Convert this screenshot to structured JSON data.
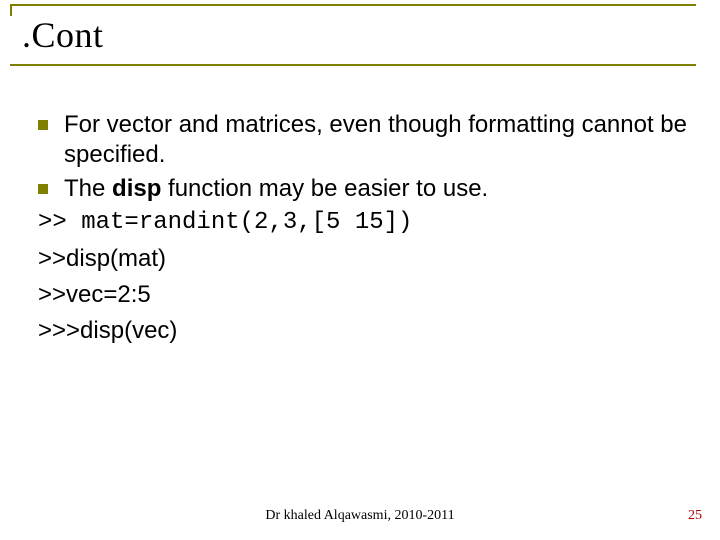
{
  "title": ".Cont",
  "bullets": [
    {
      "html": "For vector and matrices, even though formatting cannot be specified."
    },
    {
      "html": "The <span class=\"bold\">disp</span> function may be easier to use."
    }
  ],
  "code_line": ">> mat=randint(2,3,[5 15])",
  "plain_lines": [
    ">>disp(mat)",
    ">>vec=2:5",
    ">>>disp(vec)"
  ],
  "footer_center": "Dr khaled Alqawasmi, 2010-2011",
  "footer_right": "25"
}
